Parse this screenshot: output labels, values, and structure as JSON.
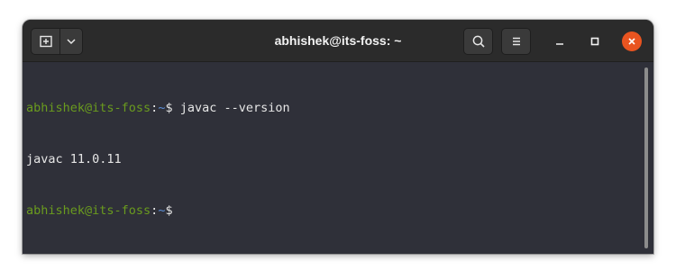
{
  "window": {
    "title": "abhishek@its-foss: ~"
  },
  "headerbar": {
    "new_tab_icon": "new-tab-icon",
    "tab_menu_icon": "chevron-down-icon",
    "search_icon": "search-icon",
    "menu_icon": "hamburger-menu-icon",
    "minimize_icon": "minimize-icon",
    "maximize_icon": "maximize-icon",
    "close_icon": "close-icon"
  },
  "colors": {
    "prompt_user": "#6a9b1e",
    "prompt_path": "#5b8dd6",
    "close_button": "#e95420",
    "terminal_bg": "#2f3039"
  },
  "terminal": {
    "lines": [
      {
        "user": "abhishek@its-foss",
        "colon": ":",
        "path": "~",
        "prompt": "$ ",
        "command": "javac --version"
      },
      {
        "output": "javac 11.0.11"
      },
      {
        "user": "abhishek@its-foss",
        "colon": ":",
        "path": "~",
        "prompt": "$",
        "command": ""
      }
    ]
  }
}
